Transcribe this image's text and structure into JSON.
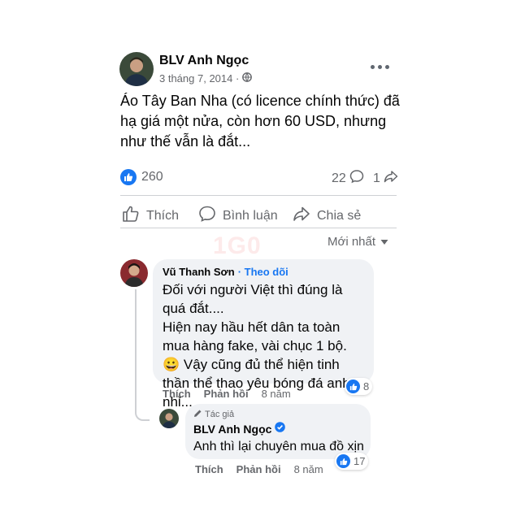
{
  "post": {
    "author": "BLV Anh Ngọc",
    "date": "3 tháng 7, 2014 ·",
    "text": "Áo Tây Ban Nha (có licence chính thức) đã hạ giá một nửa, còn hơn 60 USD, nhưng như thế vẫn là đắt...",
    "like_count": "260",
    "comment_count": "22",
    "share_count": "1"
  },
  "actions": {
    "like": "Thích",
    "comment": "Bình luận",
    "share": "Chia sẻ"
  },
  "sort": {
    "label": "Mới nhất"
  },
  "comments": [
    {
      "author": "Vũ Thanh Sơn",
      "follow": "· Theo dõi",
      "text_lines": [
        "Đối với người Việt thì đúng là quá đắt....",
        "Hiện nay hầu hết dân ta toàn mua hàng fake, vài chục 1 bộ. 😀 Vậy cũng đủ thể hiện tinh thần thể thao yêu bóng đá anh nhỉ..."
      ],
      "like": "Thích",
      "reply": "Phản hồi",
      "time": "8 năm",
      "reactions": "8"
    }
  ],
  "reply": {
    "badge": "Tác giả",
    "author": "BLV Anh Ngọc",
    "text": "Anh thì lại chuyên mua đồ xịn",
    "like": "Thích",
    "reply": "Phản hồi",
    "time": "8 năm",
    "reactions": "17"
  },
  "watermark": "1G0",
  "colors": {
    "accent": "#1877f2",
    "muted": "#65676b",
    "bubble": "#f0f2f5"
  }
}
